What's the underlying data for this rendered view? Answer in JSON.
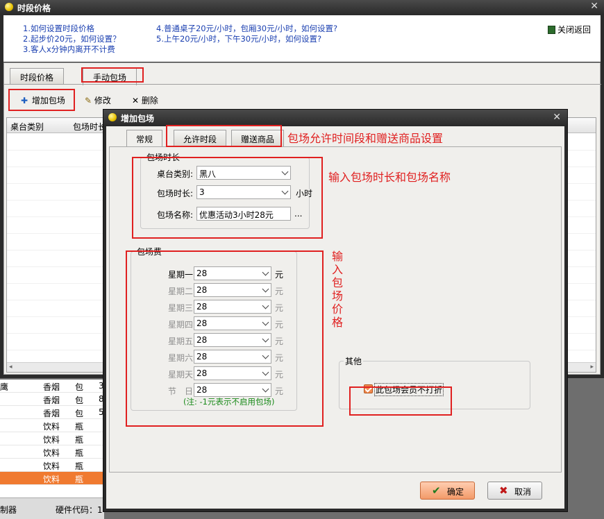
{
  "window": {
    "title": "时段价格",
    "help_links": [
      "1.如何设置时段价格",
      "2.起步价20元，如何设置？",
      "3.客人x分钟内离开不计费",
      "4.普通桌子20元/小时，包厢30元/小时，如何设置?",
      "5.上午20元/小时，下午30元/小时，如何设置?"
    ],
    "close_back": "关闭返回",
    "tabs": [
      "时段价格",
      "手动包场"
    ],
    "toolbar": {
      "add": "增加包场",
      "edit": "修改",
      "delete": "删除"
    },
    "grid_headers": [
      "桌台类别",
      "包场时长"
    ]
  },
  "background_list": {
    "rows": [
      [
        "鹰",
        "香烟",
        "包",
        "3"
      ],
      [
        "",
        "香烟",
        "包",
        "8"
      ],
      [
        "",
        "香烟",
        "包",
        "5"
      ],
      [
        "",
        "饮料",
        "瓶",
        ""
      ],
      [
        "",
        "饮料",
        "瓶",
        ""
      ],
      [
        "",
        "饮料",
        "瓶",
        ""
      ],
      [
        "",
        "饮料",
        "瓶",
        ""
      ],
      [
        "",
        "饮料",
        "瓶",
        ""
      ]
    ],
    "selected_index": 7,
    "status": [
      "制器",
      "硬件代码：1"
    ]
  },
  "dialog": {
    "title": "增加包场",
    "tabs": [
      "常规",
      "允许时段",
      "赠送商品"
    ],
    "duration_group": {
      "legend": "包场时长",
      "table_type_label": "桌台类别:",
      "table_type_value": "黑八",
      "duration_label": "包场时长:",
      "duration_value": "3",
      "duration_unit": "小时",
      "name_label": "包场名称:",
      "name_value": "优惠活动3小时28元",
      "name_more": "..."
    },
    "fee_group": {
      "legend": "包场费",
      "rows": [
        {
          "day": "星期一",
          "value": "28",
          "unit": "元",
          "enabled": true
        },
        {
          "day": "星期二",
          "value": "28",
          "unit": "元",
          "enabled": false
        },
        {
          "day": "星期三",
          "value": "28",
          "unit": "元",
          "enabled": false
        },
        {
          "day": "星期四",
          "value": "28",
          "unit": "元",
          "enabled": false
        },
        {
          "day": "星期五",
          "value": "28",
          "unit": "元",
          "enabled": false
        },
        {
          "day": "星期六",
          "value": "28",
          "unit": "元",
          "enabled": false
        },
        {
          "day": "星期天",
          "value": "28",
          "unit": "元",
          "enabled": false
        },
        {
          "day": "节　日",
          "value": "28",
          "unit": "元",
          "enabled": false
        }
      ],
      "note": "(注: -1元表示不启用包场)"
    },
    "other_group": {
      "legend": "其他",
      "checkbox_label": "此包场会员不打折",
      "checked": true
    },
    "ok": "确定",
    "cancel": "取消"
  },
  "annotations": {
    "tabs_note": "包场允许时间段和赠送商品设置",
    "duration_note": "输入包场时长和包场名称",
    "fee_note": "输入包场价格"
  },
  "colors": {
    "accent": "#f07a30",
    "annotation": "#e02020",
    "link": "#1a3fb0",
    "note": "#1a8a1a"
  }
}
